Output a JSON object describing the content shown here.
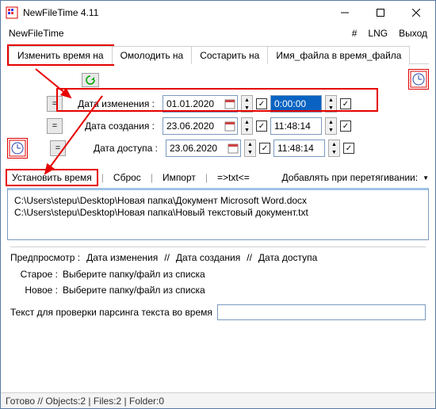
{
  "window": {
    "title": "NewFileTime 4.11"
  },
  "menubar": {
    "app": "NewFileTime",
    "hash": "#",
    "lng": "LNG",
    "exit": "Выход"
  },
  "tabs": {
    "change": "Изменить время на",
    "younger": "Омолодить на",
    "older": "Состарить на",
    "filename": "Имя_файла в время_файла"
  },
  "labels": {
    "modified": "Дата изменения :",
    "created": "Дата создания :",
    "accessed": "Дата доступа :"
  },
  "rows": {
    "modified": {
      "eq": "=",
      "date": "01.01.2020",
      "chk1": "✓",
      "time": "0:00:00",
      "chk2": "✓"
    },
    "created": {
      "eq": "=",
      "date": "23.06.2020",
      "chk1": "✓",
      "time": "11:48:14",
      "chk2": "✓"
    },
    "accessed": {
      "eq": "=",
      "date": "23.06.2020",
      "chk1": "✓",
      "time": "11:48:14",
      "chk2": "✓"
    }
  },
  "commands": {
    "set": "Установить время",
    "reset": "Сброс",
    "import": "Импорт",
    "txt": "=>txt<=",
    "adddrag": "Добавлять при перетягивании:"
  },
  "files": [
    "C:\\Users\\stepu\\Desktop\\Новая папка\\Документ Microsoft Word.docx",
    "C:\\Users\\stepu\\Desktop\\Новая папка\\Новый текстовый документ.txt"
  ],
  "preview": {
    "header": "Предпросмотр  :",
    "col_mod": "Дата изменения",
    "col_cre": "Дата создания",
    "col_acc": "Дата доступа",
    "sep": "//",
    "old_label": "Старое :",
    "new_label": "Новое :",
    "old_val": "Выберите папку/файл из списка",
    "new_val": "Выберите папку/файл из списка"
  },
  "parse": {
    "label": "Текст для проверки парсинга текста во время",
    "value": ""
  },
  "status": "Готово // Objects:2 | Files:2 | Folder:0"
}
